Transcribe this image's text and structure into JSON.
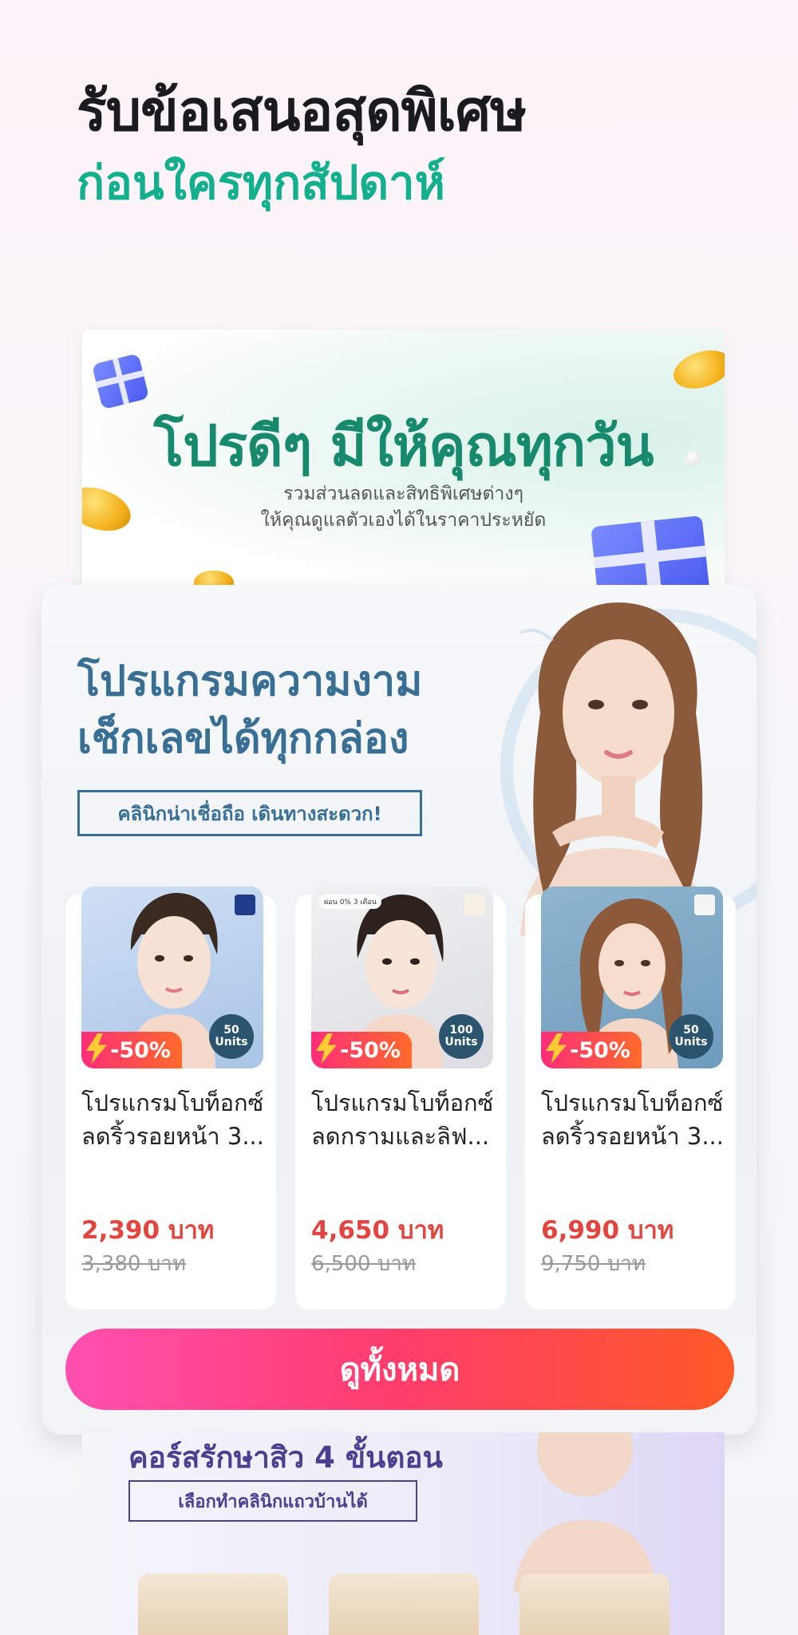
{
  "headline": {
    "line1": "รับข้อเสนอสุดพิเศษ",
    "line2": "ก่อนใครทุกสัปดาห์"
  },
  "promo": {
    "title": "โปรดีๆ มีให้คุณทุกวัน",
    "sub1": "รวมส่วนลดและสิทธิพิเศษต่างๆ",
    "sub2": "ให้คุณดูแลตัวเองได้ในราคาประหยัด"
  },
  "main": {
    "title1": "โปรแกรมความงาม",
    "title2": "เช็กเลขได้ทุกกล่อง",
    "tag": "คลินิกน่าเชื่อถือ เดินทางสะดวก!",
    "products": [
      {
        "badge": "-50%",
        "units_num": "50",
        "units_label": "Units",
        "name": "โปรแกรมโบท็อกซ์ลดริ้วรอยหน้า 3...",
        "price": "2,390 บาท",
        "old_price": "3,380 บาท"
      },
      {
        "badge": "-50%",
        "units_num": "100",
        "units_label": "Units",
        "name": "โปรแกรมโบท็อกซ์ลดกรามและลิฟ...",
        "price": "4,650 บาท",
        "old_price": "6,500 บาท",
        "tag": "ผ่อน 0% 3 เดือน"
      },
      {
        "badge": "-50%",
        "units_num": "50",
        "units_label": "Units",
        "name": "โปรแกรมโบท็อกซ์ลดริ้วรอยหน้า 3...",
        "price": "6,990 บาท",
        "old_price": "9,750 บาท"
      }
    ],
    "cta": "ดูทั้งหมด"
  },
  "bottom": {
    "title": "คอร์สรักษาสิว 4 ขั้นตอน",
    "tag": "เลือกทำคลินิกแถวบ้านได้"
  },
  "colors": {
    "accent_green": "#13b08d",
    "main_blue": "#3a6f95",
    "price_red": "#e0453f",
    "cta_start": "#ff4fb0",
    "cta_end": "#ff5a26",
    "purple": "#4c3f8f"
  }
}
